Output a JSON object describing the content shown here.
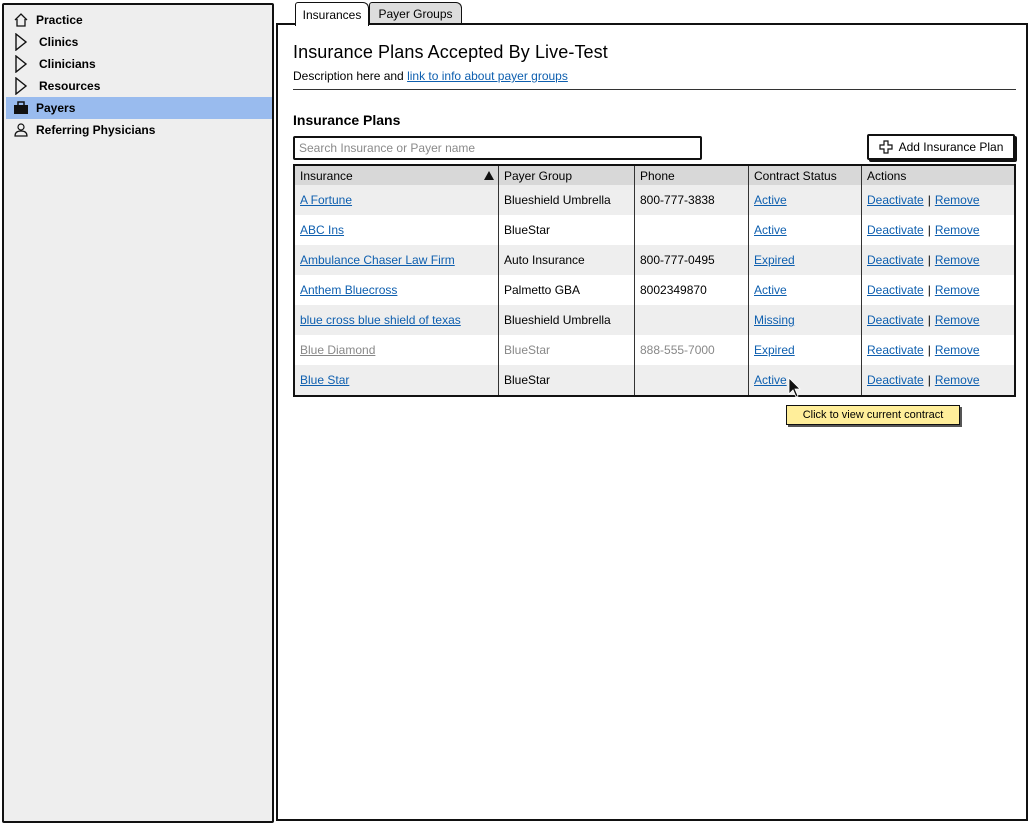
{
  "sidebar": {
    "items": [
      {
        "label": "Practice",
        "icon": "home-icon",
        "selected": false
      },
      {
        "label": "Clinics",
        "icon": "triangle-expand-icon",
        "selected": false
      },
      {
        "label": "Clinicians",
        "icon": "triangle-expand-icon",
        "selected": false
      },
      {
        "label": "Resources",
        "icon": "triangle-expand-icon",
        "selected": false
      },
      {
        "label": "Payers",
        "icon": "briefcase-icon",
        "selected": true
      },
      {
        "label": "Referring Physicians",
        "icon": "user-icon",
        "selected": false
      }
    ]
  },
  "tabs": [
    {
      "label": "Insurances",
      "active": true
    },
    {
      "label": "Payer Groups",
      "active": false
    }
  ],
  "main": {
    "title": "Insurance Plans Accepted By Live-Test",
    "description_prefix": "Description here and ",
    "description_link": "link to info about payer groups",
    "section_title": "Insurance Plans",
    "search_placeholder": "Search Insurance or Payer name",
    "add_button_label": "Add Insurance Plan"
  },
  "table": {
    "headers": [
      "Insurance",
      "Payer Group",
      "Phone",
      "Contract Status",
      "Actions"
    ],
    "sort_icon": "sort-ascending-icon",
    "separator": "|",
    "rows": [
      {
        "insurance": "A Fortune",
        "payer_group": "Blueshield Umbrella",
        "phone": "800-777-3838",
        "status": "Active",
        "action": "Deactivate",
        "remove": "Remove"
      },
      {
        "insurance": "ABC Ins",
        "payer_group": "BlueStar",
        "phone": "",
        "status": "Active",
        "action": "Deactivate",
        "remove": "Remove"
      },
      {
        "insurance": "Ambulance Chaser Law Firm",
        "payer_group": "Auto Insurance",
        "phone": "800-777-0495",
        "status": "Expired",
        "action": "Deactivate",
        "remove": "Remove"
      },
      {
        "insurance": "Anthem Bluecross",
        "payer_group": "Palmetto GBA",
        "phone": "8002349870",
        "status": "Active",
        "action": "Deactivate",
        "remove": "Remove"
      },
      {
        "insurance": "blue cross blue shield of texas",
        "payer_group": "Blueshield Umbrella",
        "phone": "",
        "status": "Missing",
        "action": "Deactivate",
        "remove": "Remove"
      },
      {
        "insurance": "Blue Diamond",
        "payer_group": "BlueStar",
        "phone": "888-555-7000",
        "status": "Expired",
        "action": "Reactivate",
        "remove": "Remove",
        "inactive": true
      },
      {
        "insurance": "Blue Star",
        "payer_group": "BlueStar",
        "phone": "",
        "status": "Active",
        "action": "Deactivate",
        "remove": "Remove"
      }
    ]
  },
  "tooltip": {
    "text": "Click to view current contract"
  },
  "colors": {
    "link": "#0e5faf",
    "selected_nav": "#99bbee",
    "tooltip_bg": "#ffee9a",
    "muted_text": "#888888",
    "header_bg": "#d8d8d8",
    "zebra_row": "#eeeeee"
  }
}
